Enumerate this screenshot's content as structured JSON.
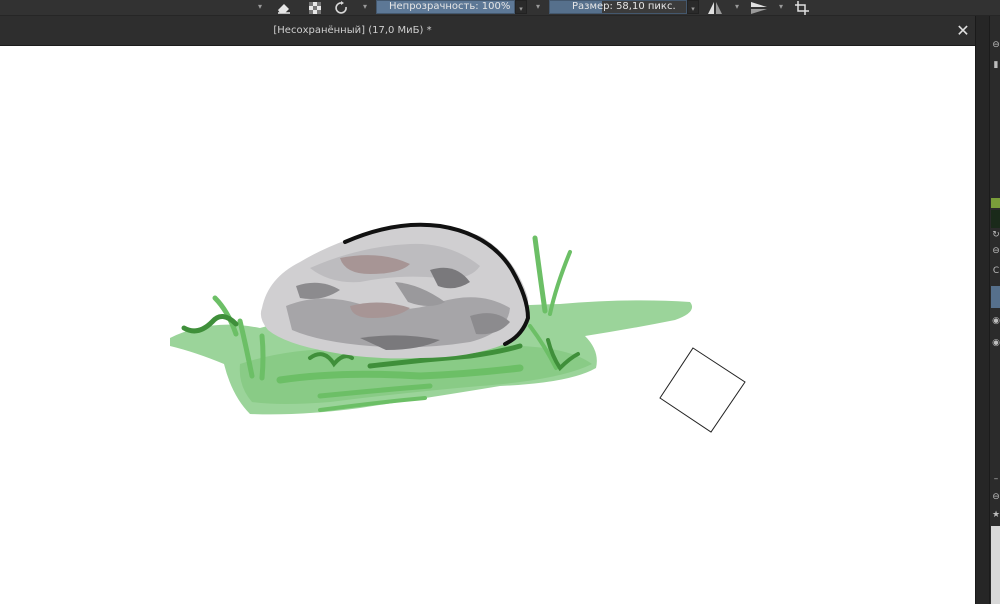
{
  "toolbar": {
    "opacity": {
      "label": "Непрозрачность: 100%",
      "fraction": 1.0
    },
    "size": {
      "label": "Размер: 58,10 пикс.",
      "fraction": 0.38
    },
    "icons": [
      "dropdown-arrow-icon",
      "eraser-icon",
      "alpha-lock-icon",
      "rotate-icon",
      "mirror-horizontal-icon",
      "mirror-vertical-icon",
      "crop-icon"
    ]
  },
  "document": {
    "title": "[Несохранённый]  (17,0 МиБ) *",
    "close_label": "✕"
  },
  "canvas": {
    "background": "#ffffff"
  },
  "dock": {
    "letter": "C"
  },
  "colors": {
    "grass_light": "#9bd49a",
    "grass_mid": "#6cbf66",
    "grass_dark": "#3f8f3a",
    "rock_light": "#d0cfd1",
    "rock_mid": "#a6a5a8",
    "rock_dark": "#7a797c",
    "rock_pink": "#a79595"
  }
}
